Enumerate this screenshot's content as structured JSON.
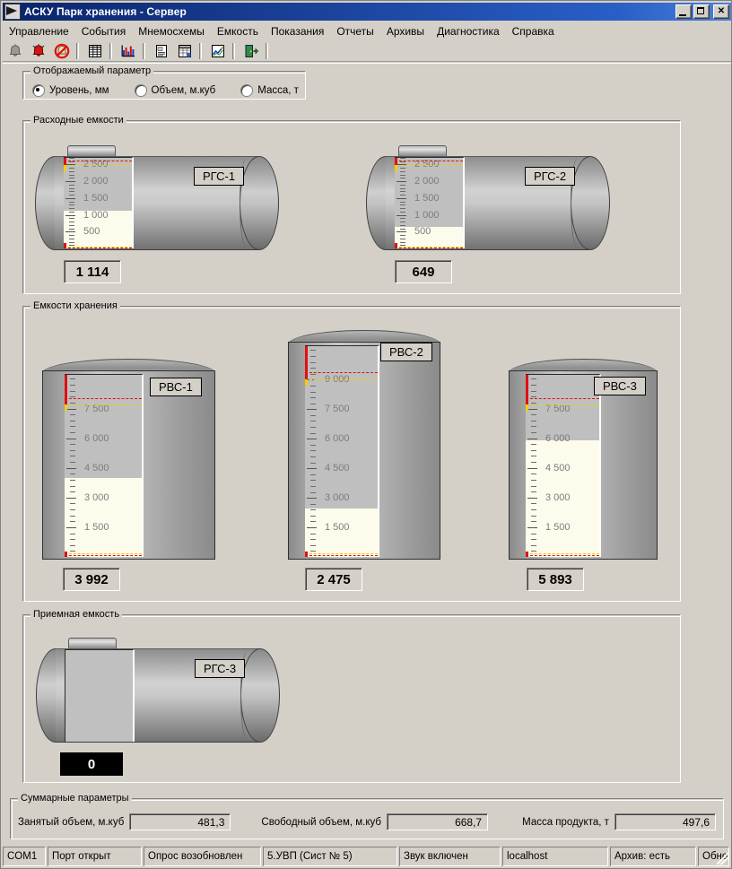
{
  "window": {
    "title": "АСКУ Парк хранения - Сервер",
    "icon": "app-icon",
    "buttons": {
      "minimize": "_",
      "maximize": "□",
      "close": "✕"
    }
  },
  "menu": {
    "items": [
      {
        "label": "Управление"
      },
      {
        "label": "События"
      },
      {
        "label": "Мнемосхемы"
      },
      {
        "label": "Емкость"
      },
      {
        "label": "Показания"
      },
      {
        "label": "Отчеты"
      },
      {
        "label": "Архивы"
      },
      {
        "label": "Диагностика"
      },
      {
        "label": "Справка"
      }
    ]
  },
  "toolbar": {
    "buttons": [
      {
        "name": "alarm-disabled-icon"
      },
      {
        "name": "alarm-active-icon"
      },
      {
        "name": "alarm-mute-icon"
      },
      {
        "name": "table-view-icon"
      },
      {
        "name": "bar-chart-icon"
      },
      {
        "name": "report-icon"
      },
      {
        "name": "spreadsheet-icon"
      },
      {
        "name": "trend-chart-icon"
      },
      {
        "name": "exit-icon"
      }
    ]
  },
  "param_group": {
    "title": "Отображаемый параметр",
    "options": [
      {
        "label": "Уровень, мм",
        "checked": true
      },
      {
        "label": "Объем, м.куб",
        "checked": false
      },
      {
        "label": "Масса, т",
        "checked": false
      }
    ]
  },
  "groups": {
    "service": "Расходные емкости",
    "storage": "Емкости хранения",
    "receiving": "Приемная емкость",
    "summary": "Суммарные параметры"
  },
  "tanks": {
    "service": [
      {
        "label": "РГС-1",
        "value": "1 114",
        "scale_max": 2700,
        "level": 1114,
        "ticks": [
          500,
          1000,
          1500,
          2000,
          2500
        ],
        "alarm_hi": 2620,
        "warn_hi": 2480,
        "warn_lo": 60,
        "alarm_lo": 30
      },
      {
        "label": "РГС-2",
        "value": "649",
        "scale_max": 2700,
        "level": 649,
        "ticks": [
          500,
          1000,
          1500,
          2000,
          2500
        ],
        "alarm_hi": 2620,
        "warn_hi": 2480,
        "warn_lo": 60,
        "alarm_lo": 30
      }
    ],
    "storage": [
      {
        "label": "РВС-1",
        "value": "3 992",
        "scale_max": 9200,
        "level": 3992,
        "ticks": [
          1500,
          3000,
          4500,
          6000,
          7500
        ],
        "alarm_hi": 8000,
        "warn_hi": 7700,
        "warn_lo": 180,
        "alarm_lo": 90
      },
      {
        "label": "РВС-2",
        "value": "2 475",
        "scale_max": 10700,
        "level": 2475,
        "ticks": [
          1500,
          3000,
          4500,
          6000,
          7500,
          9000
        ],
        "alarm_hi": 9400,
        "warn_hi": 9000,
        "warn_lo": 200,
        "alarm_lo": 100
      },
      {
        "label": "РВС-3",
        "value": "5 893",
        "scale_max": 9200,
        "level": 5893,
        "ticks": [
          1500,
          3000,
          4500,
          6000,
          7500
        ],
        "alarm_hi": 8000,
        "warn_hi": 7700,
        "warn_lo": 180,
        "alarm_lo": 90
      }
    ],
    "receiving": [
      {
        "label": "РГС-3",
        "value": "0",
        "scale_max": 0,
        "level": 0,
        "ticks": [],
        "dark_value": true
      }
    ]
  },
  "summary": {
    "fields": [
      {
        "label": "Занятый объем, м.куб",
        "value": "481,3"
      },
      {
        "label": "Свободный объем, м.куб",
        "value": "668,7"
      },
      {
        "label": "Масса продукта, т",
        "value": "497,6"
      }
    ]
  },
  "statusbar": {
    "cells": [
      {
        "text": "COM1"
      },
      {
        "text": "Порт открыт"
      },
      {
        "text": "Опрос возобновлен"
      },
      {
        "text": "5.УВП (Сист № 5)"
      },
      {
        "text": "Звук включен"
      },
      {
        "text": "localhost"
      },
      {
        "text": "Архив: есть"
      },
      {
        "text": "Обновление:"
      }
    ]
  },
  "colors": {
    "face": "#d4d0c8",
    "alarm": "#e01010",
    "warn": "#f0d000",
    "product": "#fdfbec",
    "empty": "#bfbfbf",
    "title_bar": "#0a246a"
  }
}
